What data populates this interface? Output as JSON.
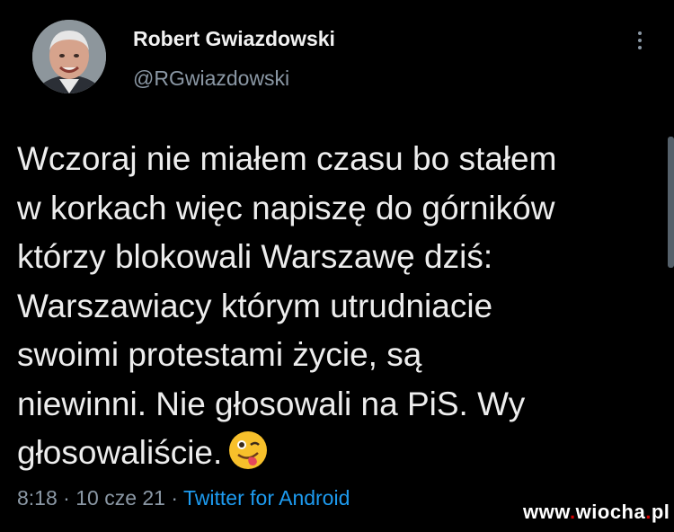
{
  "tweet": {
    "author_name": "Robert Gwiazdowski",
    "author_handle": "@RGwiazdowski",
    "text_lines": [
      "Wczoraj nie miałem czasu bo stałem",
      "w korkach więc napiszę do górników",
      "którzy blokowali Warszawę dziś:",
      "Warszawiacy którym utrudniacie",
      "swoimi protestami życie, są",
      "niewinni. Nie głosowali na PiS. Wy",
      "głosowaliście."
    ],
    "emoji": "winking-face-with-tongue",
    "time": "8:18",
    "separator": "·",
    "date": "10 cze 21",
    "source": "Twitter for Android"
  },
  "watermark": {
    "prefix": "www",
    "dot1": ".",
    "middle": "wiocha",
    "dot2": ".",
    "suffix": "pl"
  },
  "colors": {
    "background": "#000000",
    "text": "#e7e9ea",
    "secondary": "#8b98a5",
    "link": "#1d9bf0",
    "watermark_dot": "#d40000"
  },
  "icons": {
    "more": "more-vertical-icon",
    "avatar": "profile-photo"
  }
}
